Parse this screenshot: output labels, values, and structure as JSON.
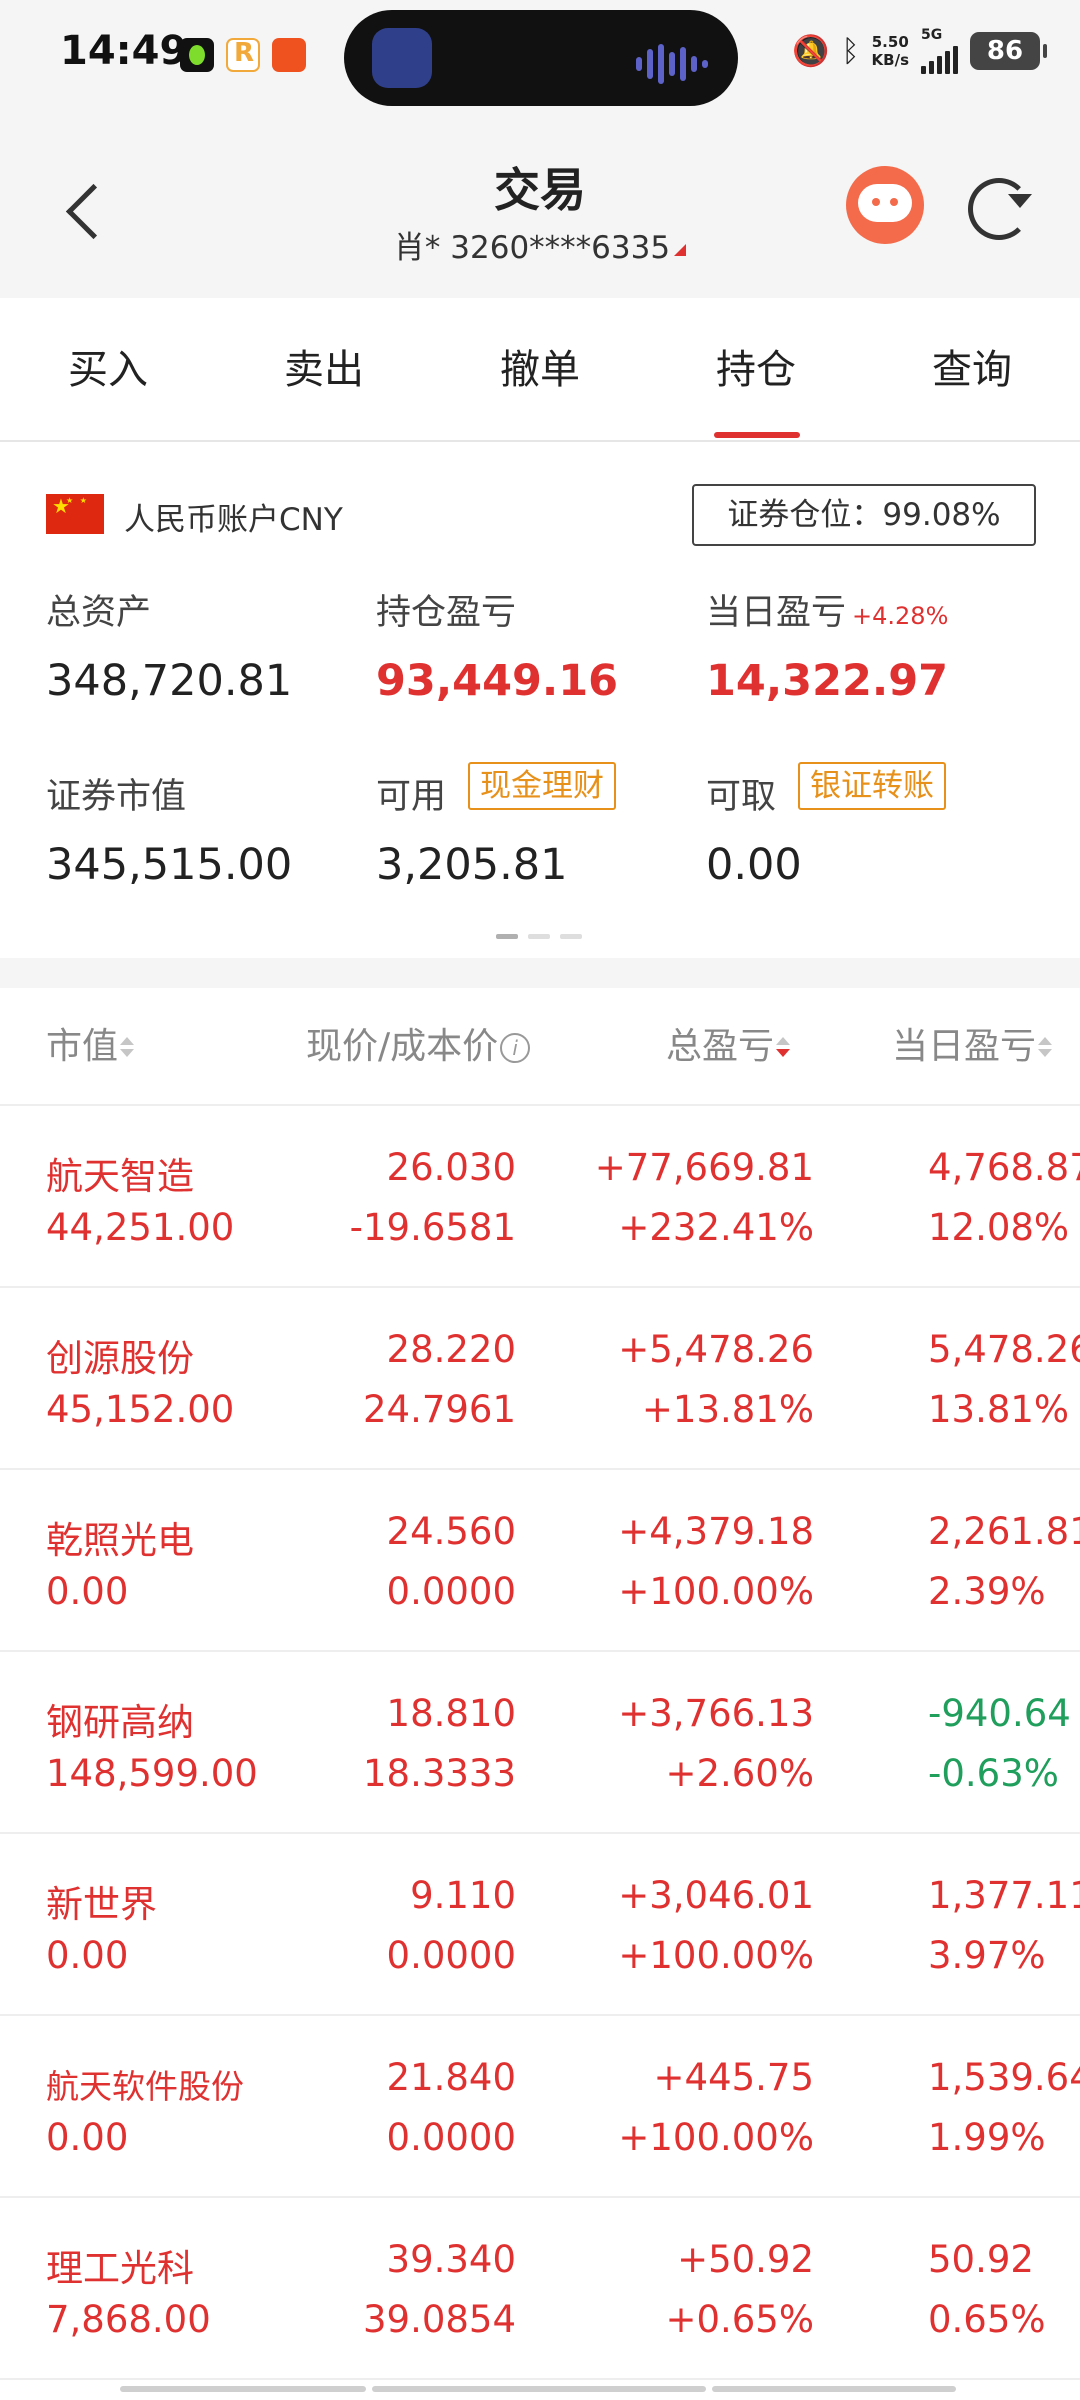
{
  "status_bar": {
    "time": "14:49",
    "network_speed_value": "5.50",
    "network_speed_unit": "KB/s",
    "network_type": "5G",
    "battery": "86",
    "icons": [
      "mute-icon",
      "bluetooth-icon",
      "signal-icon"
    ]
  },
  "header": {
    "title": "交易",
    "account": "肖* 3260****6335"
  },
  "tabs": [
    {
      "label": "买入"
    },
    {
      "label": "卖出"
    },
    {
      "label": "撤单"
    },
    {
      "label": "持仓",
      "active": true
    },
    {
      "label": "查询"
    }
  ],
  "summary": {
    "account_type": "人民币账户CNY",
    "position_ratio": "证券仓位：99.08%",
    "total_assets_label": "总资产",
    "total_assets": "348,720.81",
    "position_pl_label": "持仓盈亏",
    "position_pl": "93,449.16",
    "daily_pl_label": "当日盈亏",
    "daily_pl_pct": "+4.28%",
    "daily_pl": "14,322.97",
    "market_value_label": "证券市值",
    "market_value": "345,515.00",
    "available_label": "可用",
    "cash_mgmt_link": "现金理财",
    "available": "3,205.81",
    "withdrawable_label": "可取",
    "bank_transfer_link": "银证转账",
    "withdrawable": "0.00"
  },
  "table": {
    "headers": {
      "market_value": "市值",
      "price_cost": "现价/成本价",
      "total_pl": "总盈亏",
      "daily_pl": "当日盈亏"
    },
    "rows": [
      {
        "name": "航天智造",
        "market_value": "44,251.00",
        "price": "26.030",
        "cost": "-19.6581",
        "total_pl": "+77,669.81",
        "total_pl_pct": "+232.41%",
        "day_pl": "4,768.87",
        "day_pl_pct": "12.08%",
        "day_negative": false
      },
      {
        "name": "创源股份",
        "market_value": "45,152.00",
        "price": "28.220",
        "cost": "24.7961",
        "total_pl": "+5,478.26",
        "total_pl_pct": "+13.81%",
        "day_pl": "5,478.26",
        "day_pl_pct": "13.81%",
        "day_negative": false
      },
      {
        "name": "乾照光电",
        "market_value": "0.00",
        "price": "24.560",
        "cost": "0.0000",
        "total_pl": "+4,379.18",
        "total_pl_pct": "+100.00%",
        "day_pl": "2,261.81",
        "day_pl_pct": "2.39%",
        "day_negative": false
      },
      {
        "name": "钢研高纳",
        "market_value": "148,599.00",
        "price": "18.810",
        "cost": "18.3333",
        "total_pl": "+3,766.13",
        "total_pl_pct": "+2.60%",
        "day_pl": "-940.64",
        "day_pl_pct": "-0.63%",
        "day_negative": true
      },
      {
        "name": "新世界",
        "market_value": "0.00",
        "price": "9.110",
        "cost": "0.0000",
        "total_pl": "+3,046.01",
        "total_pl_pct": "+100.00%",
        "day_pl": "1,377.11",
        "day_pl_pct": "3.97%",
        "day_negative": false
      },
      {
        "name": "航天软件股份",
        "market_value": "0.00",
        "price": "21.840",
        "cost": "0.0000",
        "total_pl": "+445.75",
        "total_pl_pct": "+100.00%",
        "day_pl": "1,539.64",
        "day_pl_pct": "1.99%",
        "day_negative": false
      },
      {
        "name": "理工光科",
        "market_value": "7,868.00",
        "price": "39.340",
        "cost": "39.0854",
        "total_pl": "+50.92",
        "total_pl_pct": "+0.65%",
        "day_pl": "50.92",
        "day_pl_pct": "0.65%",
        "day_negative": false
      }
    ]
  },
  "colors": {
    "up": "#e03131",
    "down": "#1f9e5c",
    "accent_link": "#e8911a",
    "background": "#f5f5f5"
  }
}
